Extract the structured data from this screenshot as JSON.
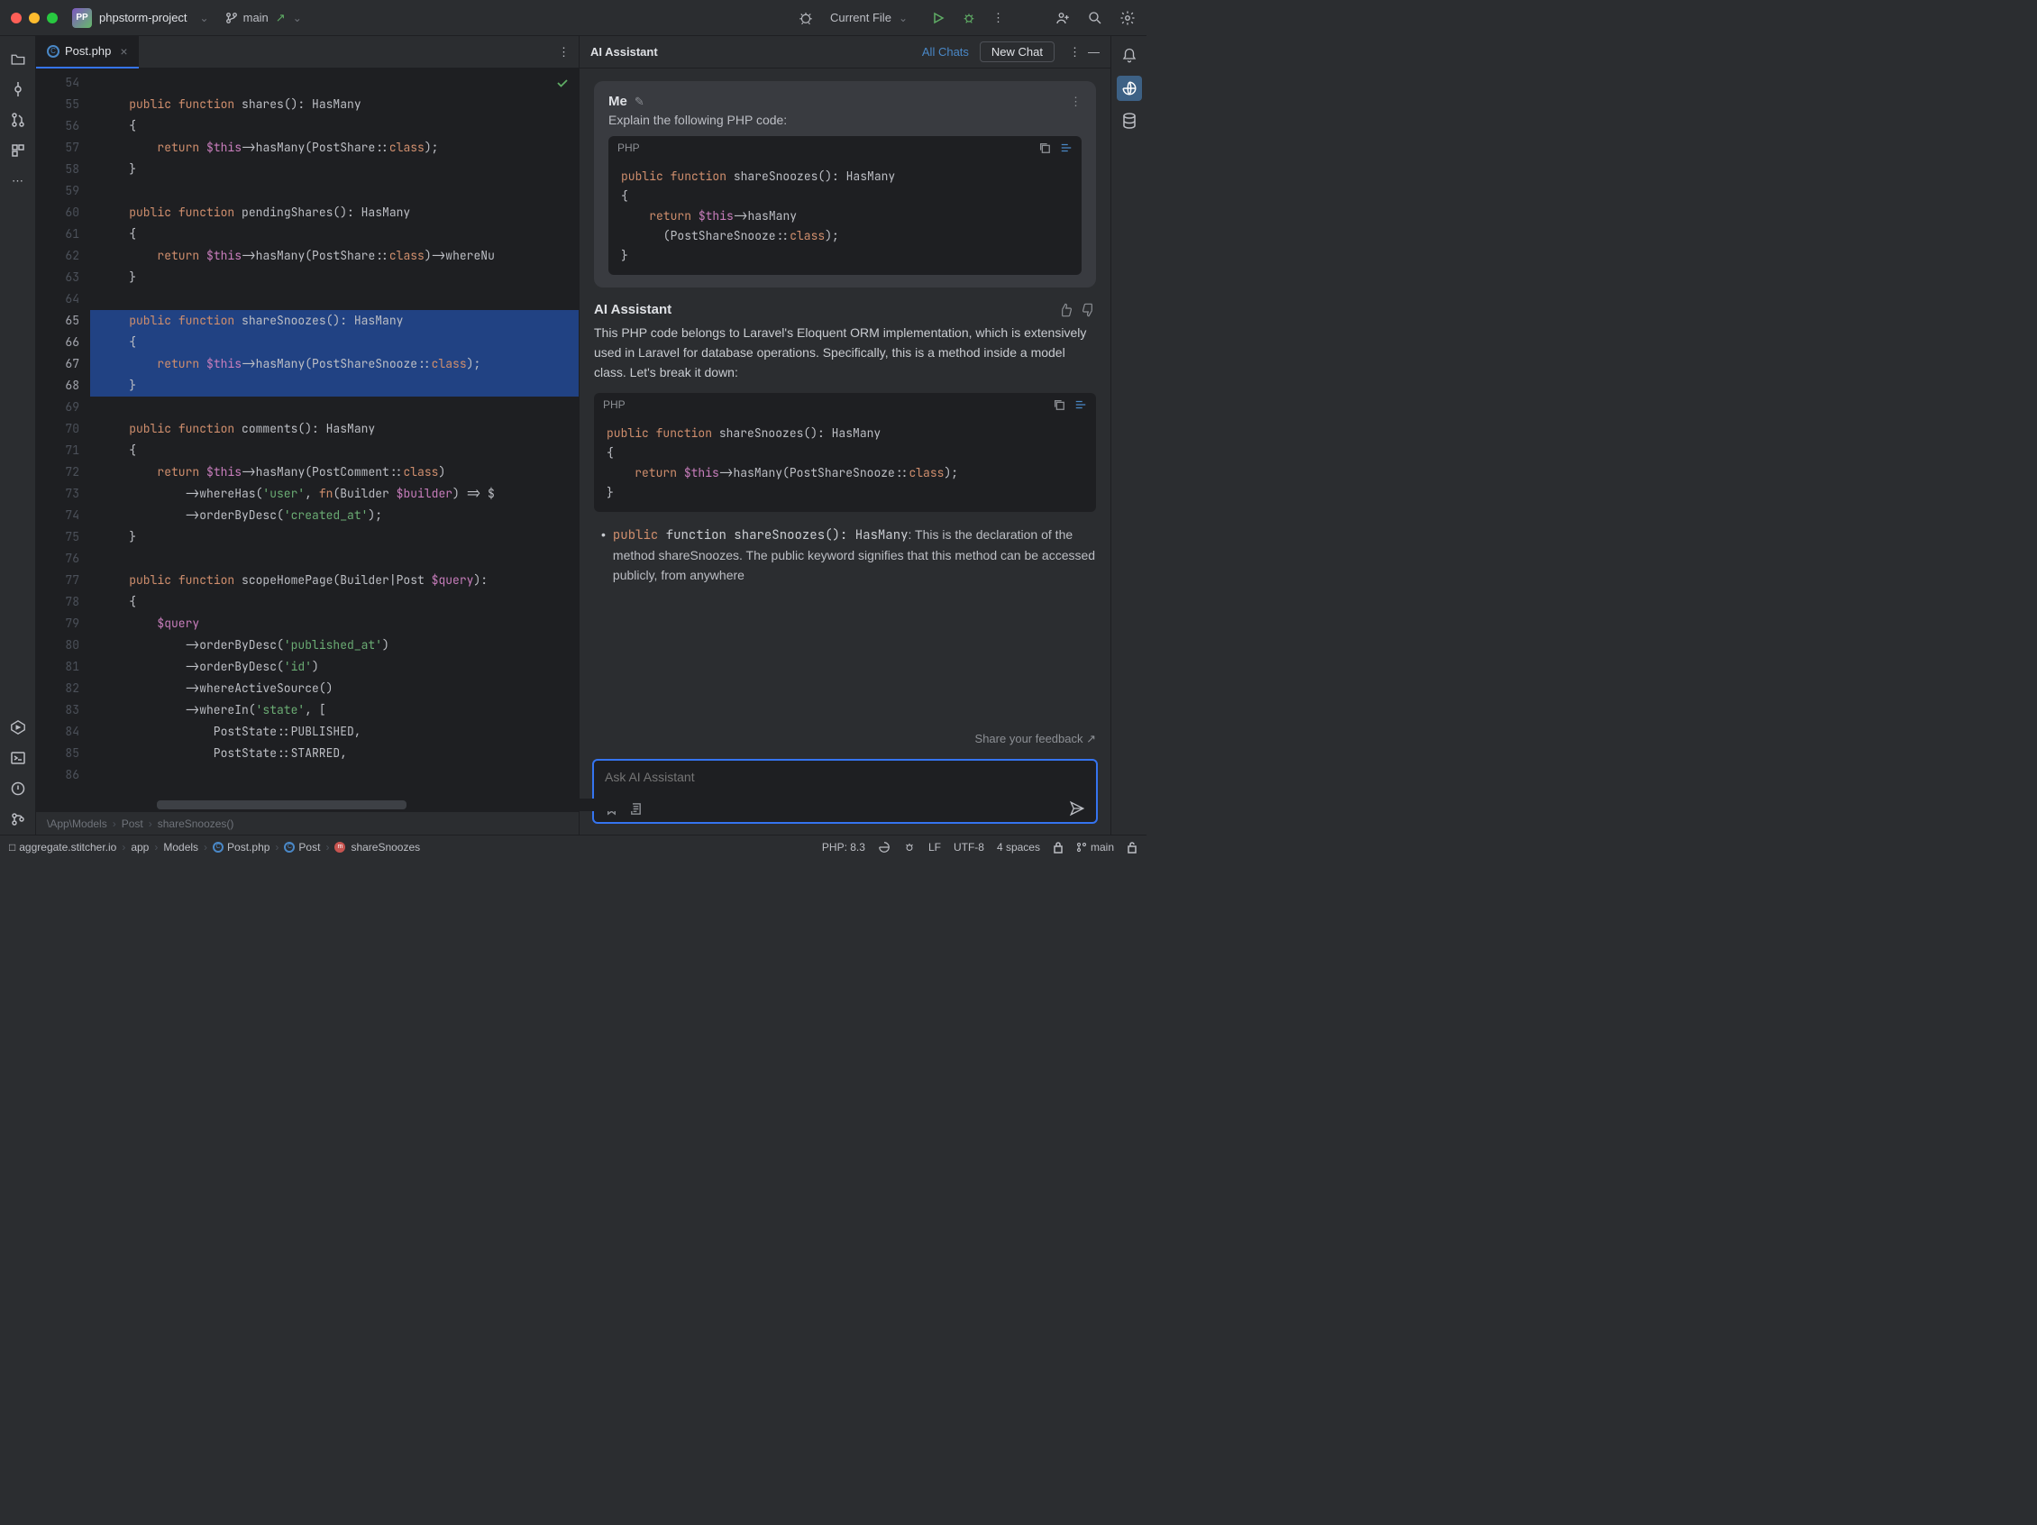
{
  "title_bar": {
    "project_badge": "PP",
    "project_name": "phpstorm-project",
    "branch_name": "main",
    "run_config": "Current File"
  },
  "tabs": {
    "file_name": "Post.php"
  },
  "gutter": {
    "start": 54,
    "end": 86
  },
  "editor": {
    "lines": [
      "",
      "    public function shares(): HasMany",
      "    {",
      "        return $this->hasMany(PostShare::class);",
      "    }",
      "",
      "    public function pendingShares(): HasMany",
      "    {",
      "        return $this->hasMany(PostShare::class)->whereNu",
      "    }",
      "",
      "    public function shareSnoozes(): HasMany",
      "    {",
      "        return $this->hasMany(PostShareSnooze::class);",
      "    }",
      "",
      "    public function comments(): HasMany",
      "    {",
      "        return $this->hasMany(PostComment::class)",
      "            ->whereHas('user', fn(Builder $builder) => $",
      "            ->orderByDesc('created_at');",
      "    }",
      "",
      "    public function scopeHomePage(Builder|Post $query):",
      "    {",
      "        $query",
      "            ->orderByDesc('published_at')",
      "            ->orderByDesc('id')",
      "            ->whereActiveSource()",
      "            ->whereIn('state', [",
      "                PostState::PUBLISHED,",
      "                PostState::STARRED,",
      ""
    ],
    "selected_start": 65,
    "selected_end": 68,
    "breadcrumb1": "\\App\\Models",
    "breadcrumb2": "Post",
    "breadcrumb3": "shareSnoozes()"
  },
  "assistant": {
    "title": "AI Assistant",
    "all_chats": "All Chats",
    "new_chat": "New Chat",
    "user_name": "Me",
    "user_prompt": "Explain the following PHP code:",
    "code_lang": "PHP",
    "user_code": "public function shareSnoozes(): HasMany\n{\n    return $this->hasMany\n      (PostShareSnooze::class);\n}",
    "ai_name": "AI Assistant",
    "ai_text": "This PHP code belongs to Laravel's Eloquent ORM implementation, which is extensively used in Laravel for database operations. Specifically, this is a method inside a model class. Let's break it down:",
    "ai_code": "public function shareSnoozes(): HasMany\n{\n    return $this->hasMany(PostShareSnooze::class);\n}",
    "bullet_pre": "public function shareSnoozes(): HasMany",
    "bullet_text": ": This is the declaration of the method shareSnoozes. The public keyword signifies that this method can be accessed publicly, from anywhere",
    "feedback_text": "Share your feedback ↗",
    "ask_placeholder": "Ask AI Assistant"
  },
  "status": {
    "crumb1": "aggregate.stitcher.io",
    "crumb2": "app",
    "crumb3": "Models",
    "crumb4": "Post.php",
    "crumb5": "Post",
    "crumb6": "shareSnoozes",
    "php_ver": "PHP: 8.3",
    "line_sep": "LF",
    "enc": "UTF-8",
    "indent": "4 spaces",
    "branch": "main"
  }
}
